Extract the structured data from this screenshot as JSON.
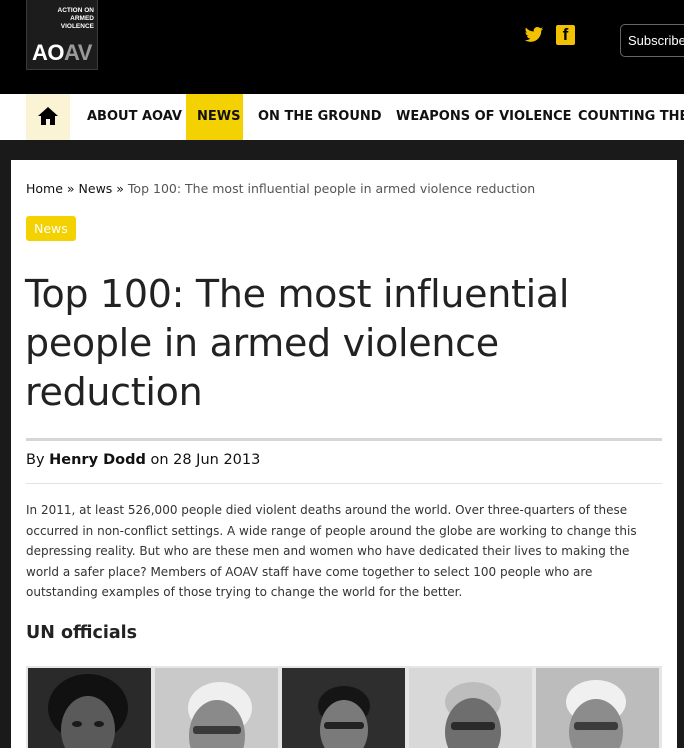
{
  "brand": {
    "tagline": "ACTION ON ARMED VIOLENCE",
    "logo_text": "AOAV"
  },
  "header": {
    "twitter_icon": "twitter-icon",
    "facebook_icon": "facebook-icon",
    "subscribe_label": "Subscribe"
  },
  "nav": {
    "home_icon": "home-icon",
    "items": [
      {
        "label": "ABOUT AOAV"
      },
      {
        "label": "NEWS"
      },
      {
        "label": "ON THE GROUND"
      },
      {
        "label": "WEAPONS OF VIOLENCE"
      },
      {
        "label": "COUNTING THE"
      }
    ],
    "active_color": "#f4d100"
  },
  "breadcrumb": {
    "home": "Home",
    "sep": " » ",
    "news": "News",
    "current": "Top 100: The most influential people in armed violence reduction"
  },
  "article": {
    "category": "News",
    "title": "Top 100: The most influential people in armed violence reduction",
    "by_prefix": "By ",
    "author": "Henry Dodd",
    "on_word": " on ",
    "date": "28 Jun 2013",
    "intro": "In 2011, at least 526,000 people died violent deaths around the world.  Over three-quarters of these occurred in non-conflict settings. A wide range of people around the globe are working to change this depressing reality. But who are these men and women who have dedicated their lives to making the world a safer place? Members of AOAV staff have come together to select 100 people who are outstanding examples of those trying to change the world for the better.",
    "section_heading": "UN officials"
  },
  "colors": {
    "accent": "#f4d100",
    "header_bg": "#000000",
    "page_bg": "#1a1a1a"
  }
}
